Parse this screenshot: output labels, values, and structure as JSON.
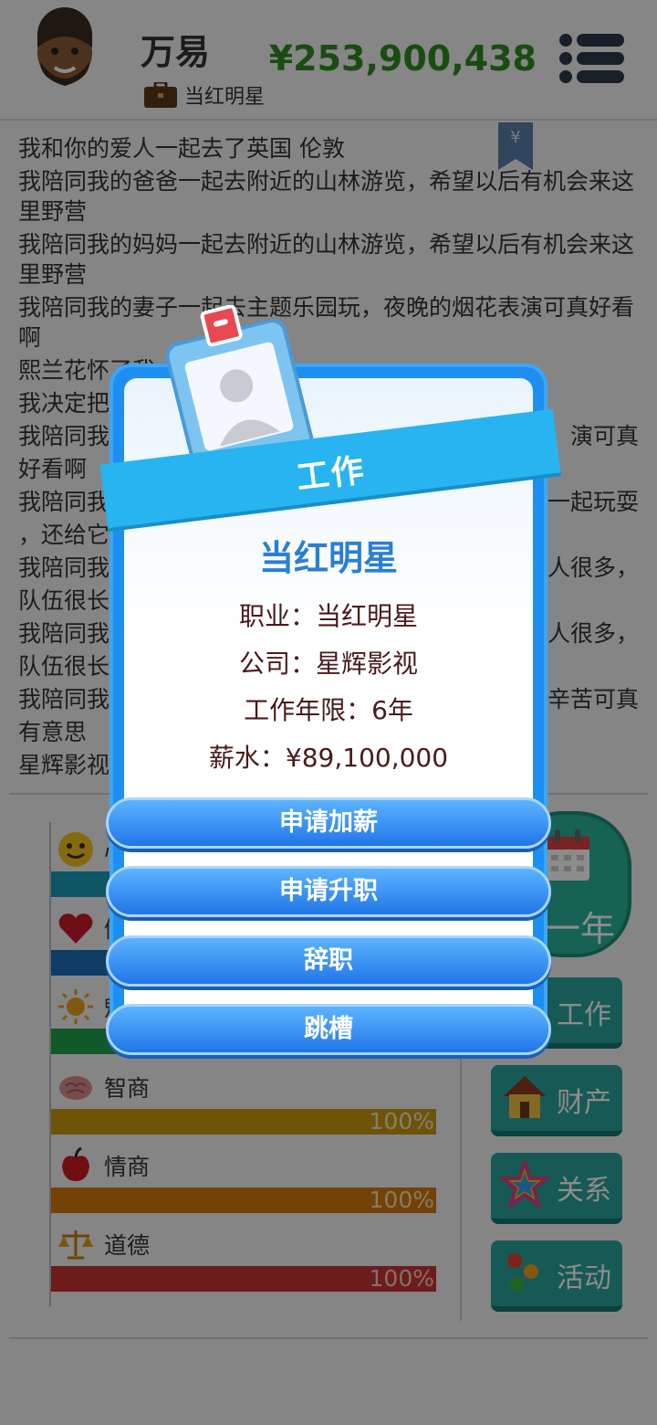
{
  "header": {
    "player_name": "万易",
    "job_title": "当红明星",
    "money": "¥253,900,438"
  },
  "log": {
    "lines": [
      "我和你的爱人一起去了英国 伦敦",
      "我陪同我的爸爸一起去附近的山林游览，希望以后有机会来这里野营",
      "我陪同我的妈妈一起去附近的山林游览，希望以后有机会来这里野营",
      "我陪同我的妻子一起去主题乐园玩，夜晚的烟花表演可真好看啊",
      "熙兰花怀了我",
      "我决定把",
      "我陪同我",
      "好看啊",
      "我陪同我",
      "，还给它",
      "我陪同我",
      "队伍很长",
      "我陪同我",
      "队伍很长",
      "我陪同我",
      "有意思",
      "星辉影视"
    ],
    "right_fragments": [
      "演可真",
      "一起玩耍",
      "人很多，",
      "人很多，",
      "辛苦可真"
    ]
  },
  "stats": [
    {
      "name": "心",
      "value": "",
      "color": "#1a9bb8",
      "percent": 100
    },
    {
      "name": "健",
      "value": "",
      "color": "#1a6db8",
      "percent": 100
    },
    {
      "name": "魅",
      "value": "",
      "color": "#22a04a",
      "percent": 100
    },
    {
      "name": "智商",
      "value": "100%",
      "color": "#c99a12",
      "percent": 100
    },
    {
      "name": "情商",
      "value": "100%",
      "color": "#d4780c",
      "percent": 100
    },
    {
      "name": "道德",
      "value": "100%",
      "color": "#c83232",
      "percent": 100
    }
  ],
  "side_buttons": {
    "year": "一年",
    "work": "工作",
    "property": "财产",
    "relations": "关系",
    "activity": "活动"
  },
  "modal": {
    "ribbon_title": "工作",
    "heading": "当红明星",
    "occupation": "职业：当红明星",
    "company": "公司：星辉影视",
    "years": "工作年限：6年",
    "salary": "薪水：¥89,100,000",
    "buttons": {
      "raise": "申请加薪",
      "promotion": "申请升职",
      "resign": "辞职",
      "job_hop": "跳槽"
    }
  }
}
